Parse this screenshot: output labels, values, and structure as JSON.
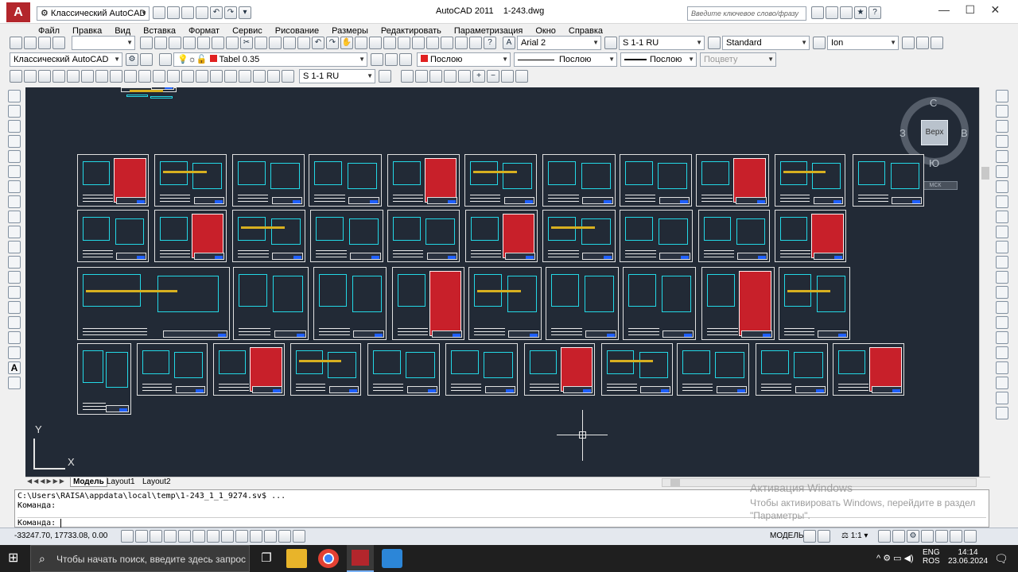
{
  "window": {
    "app": "AutoCAD 2011",
    "file": "1-243.dwg",
    "search_placeholder": "Введите ключевое слово/фразу"
  },
  "workspace": "Классический AutoCAD",
  "menu": [
    "Файл",
    "Правка",
    "Вид",
    "Вставка",
    "Формат",
    "Сервис",
    "Рисование",
    "Размеры",
    "Редактировать",
    "Параметризация",
    "Окно",
    "Справка"
  ],
  "toolbar": {
    "textstyle": "Arial 2",
    "dimstyle": "S 1-1 RU",
    "tablestyle": "Standard",
    "mleaderstyle": "Ion",
    "workspace2": "Классический AutoCAD",
    "layer": "Tabel 0.35",
    "color": "Послою",
    "linetype": "Послою",
    "lineweight": "Послою",
    "plotstyle": "Поцвету",
    "dimstyle2": "S 1-1 RU"
  },
  "viewcube": {
    "north": "С",
    "south": "Ю",
    "west": "З",
    "east": "В",
    "face": "Верх",
    "wcs": "МСК"
  },
  "tabs": [
    "Модель",
    "Layout1",
    "Layout2"
  ],
  "ucs": {
    "y": "Y",
    "x": "X"
  },
  "command": {
    "line1": "C:\\Users\\RAISA\\appdata\\local\\temp\\1-243_1_1_9274.sv$ ...",
    "line2": "Команда:",
    "prompt": "Команда:"
  },
  "activation": {
    "title": "Активация Windows",
    "text1": "Чтобы активировать Windows, перейдите в раздел",
    "text2": "\"Параметры\"."
  },
  "status": {
    "coords": "-33247.70, 17733.08, 0.00",
    "model": "МОДЕЛЬ",
    "scale": "1:1"
  },
  "taskbar": {
    "search": "Чтобы начать поиск, введите здесь запрос",
    "lang1": "ENG",
    "lang2": "ROS",
    "time": "14:14",
    "date": "23.06.2024"
  }
}
